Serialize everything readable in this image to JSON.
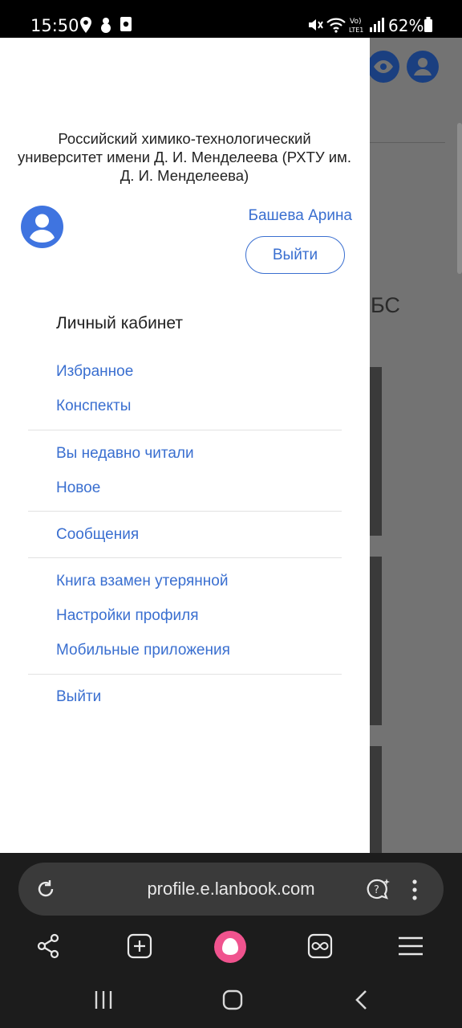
{
  "status_bar": {
    "time": "15:50",
    "battery": "62%",
    "icons": [
      "location-icon",
      "snowman-icon",
      "screenshot-icon",
      "mute-icon",
      "wifi-icon",
      "volte-icon",
      "signal-icon",
      "battery-icon"
    ]
  },
  "background_page": {
    "heading_fragment": "БС"
  },
  "drawer": {
    "university_name": "Российский химико-технологический университет имени Д. И. Менделеева (РХТУ им. Д. И. Менделеева)",
    "user_name": "Башева Арина",
    "logout_button": "Выйти",
    "section_title": "Личный кабинет",
    "menu_groups": [
      [
        "Избранное",
        "Конспекты"
      ],
      [
        "Вы недавно читали",
        "Новое"
      ],
      [
        "Сообщения"
      ],
      [
        "Книга взамен утерянной",
        "Настройки профиля",
        "Мобильные приложения"
      ],
      [
        "Выйти"
      ]
    ]
  },
  "browser": {
    "url": "profile.e.lanbook.com",
    "toolbar_icons": [
      "share-icon",
      "new-tab-icon",
      "alice-icon",
      "tabs-icon",
      "menu-icon"
    ]
  },
  "colors": {
    "link": "#3a6fd0",
    "avatar": "#3f74e0",
    "alice": "#f0538e"
  }
}
